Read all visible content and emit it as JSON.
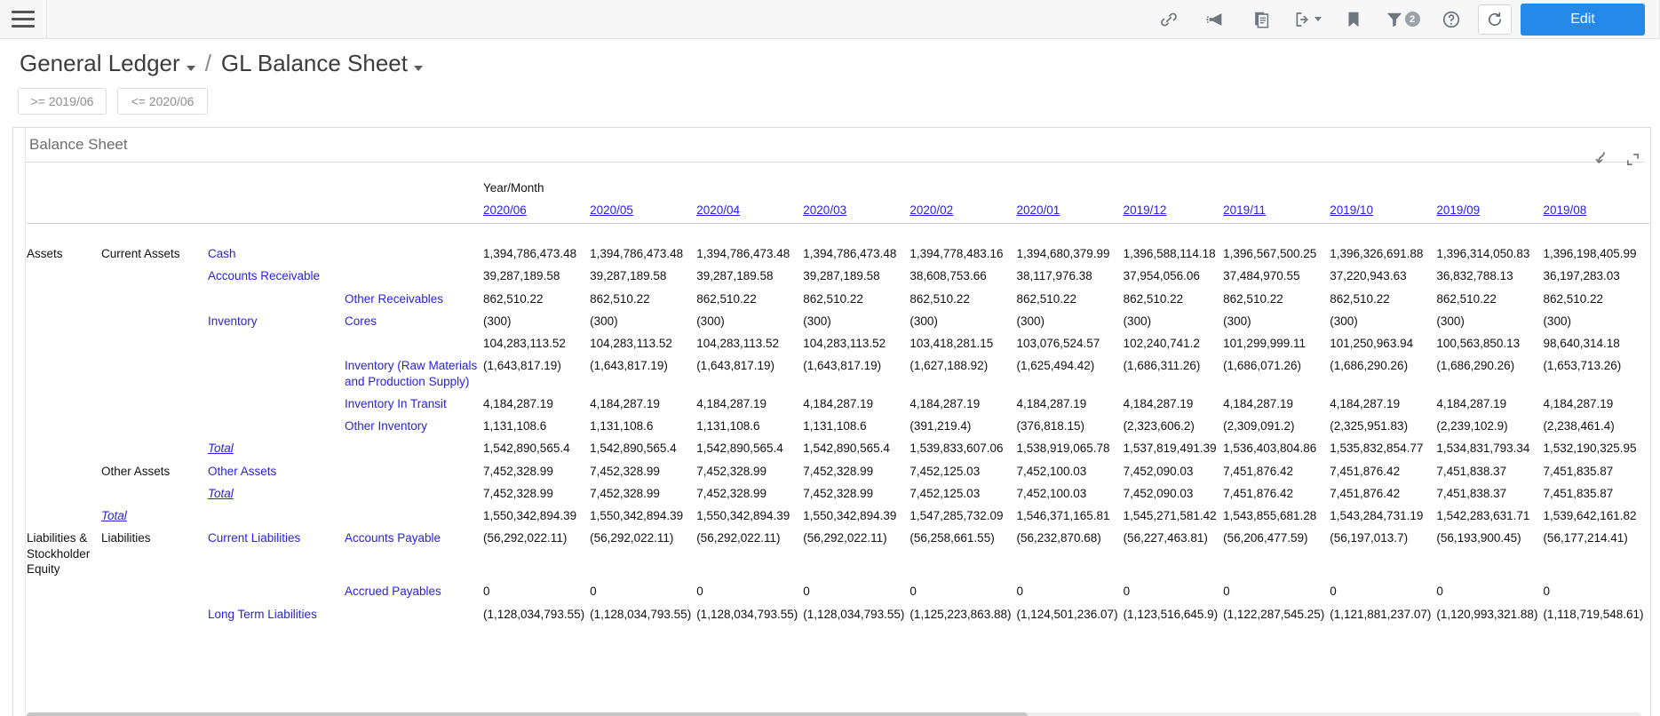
{
  "appbar": {
    "menu_icon": "hamburger-menu-icon",
    "icons": [
      {
        "name": "link-icon",
        "label": "Link"
      },
      {
        "name": "announce-icon",
        "label": "Announce"
      },
      {
        "name": "copy-icon",
        "label": "Copy"
      },
      {
        "name": "export-icon",
        "label": "Export"
      },
      {
        "name": "bookmark-icon",
        "label": "Bookmark"
      },
      {
        "name": "filter-icon",
        "label": "Filter"
      },
      {
        "name": "help-icon",
        "label": "Help"
      }
    ],
    "filter_badge": "2",
    "refresh_label": "Refresh",
    "edit_label": "Edit",
    "accent_color": "#2489e8"
  },
  "breadcrumb": {
    "root": "General Ledger",
    "separator": "/",
    "current": "GL Balance Sheet"
  },
  "filters": [
    {
      "name": "date-from-chip",
      "label": ">= 2019/06"
    },
    {
      "name": "date-to-chip",
      "label": "<= 2020/06"
    }
  ],
  "report": {
    "title": "Balance Sheet",
    "header_label": "Year/Month",
    "months": [
      "2020/06",
      "2020/05",
      "2020/04",
      "2020/03",
      "2020/02",
      "2020/01",
      "2019/12",
      "2019/11",
      "2019/10",
      "2019/09",
      "2019/08"
    ],
    "total_label": "Total"
  },
  "chart_data": {
    "type": "table",
    "title": "Balance Sheet",
    "xlabel": "Year/Month",
    "categories": [
      "2020/06",
      "2020/05",
      "2020/04",
      "2020/03",
      "2020/02",
      "2020/01",
      "2019/12",
      "2019/11",
      "2019/10",
      "2019/09",
      "2019/08"
    ],
    "rows": [
      {
        "dim1": "Assets",
        "dim2": "Current Assets",
        "dim3": "Cash",
        "dim4": "",
        "kind": "data",
        "values": [
          "1,394,786,473.48",
          "1,394,786,473.48",
          "1,394,786,473.48",
          "1,394,786,473.48",
          "1,394,778,483.16",
          "1,394,680,379.99",
          "1,396,588,114.18",
          "1,396,567,500.25",
          "1,396,326,691.88",
          "1,396,314,050.83",
          "1,396,198,405.99"
        ]
      },
      {
        "dim1": "",
        "dim2": "",
        "dim3": "Accounts Receivable",
        "dim4": "",
        "kind": "data",
        "values": [
          "39,287,189.58",
          "39,287,189.58",
          "39,287,189.58",
          "39,287,189.58",
          "38,608,753.66",
          "38,117,976.38",
          "37,954,056.06",
          "37,484,970.55",
          "37,220,943.63",
          "36,832,788.13",
          "36,197,283.03"
        ]
      },
      {
        "dim1": "",
        "dim2": "",
        "dim3": "",
        "dim4": "Other Receivables",
        "kind": "data",
        "values": [
          "862,510.22",
          "862,510.22",
          "862,510.22",
          "862,510.22",
          "862,510.22",
          "862,510.22",
          "862,510.22",
          "862,510.22",
          "862,510.22",
          "862,510.22",
          "862,510.22"
        ]
      },
      {
        "dim1": "",
        "dim2": "",
        "dim3": "Inventory",
        "dim4": "Cores",
        "kind": "data",
        "values": [
          "(300)",
          "(300)",
          "(300)",
          "(300)",
          "(300)",
          "(300)",
          "(300)",
          "(300)",
          "(300)",
          "(300)",
          "(300)"
        ]
      },
      {
        "dim1": "",
        "dim2": "",
        "dim3": "",
        "dim4": "",
        "kind": "data",
        "values": [
          "104,283,113.52",
          "104,283,113.52",
          "104,283,113.52",
          "104,283,113.52",
          "103,418,281.15",
          "103,076,524.57",
          "102,240,741.2",
          "101,299,999.11",
          "101,250,963.94",
          "100,563,850.13",
          "98,640,314.18"
        ]
      },
      {
        "dim1": "",
        "dim2": "",
        "dim3": "",
        "dim4": "Inventory (Raw Materials and Production Supply)",
        "kind": "data",
        "values": [
          "(1,643,817.19)",
          "(1,643,817.19)",
          "(1,643,817.19)",
          "(1,643,817.19)",
          "(1,627,188.92)",
          "(1,625,494.42)",
          "(1,686,311.26)",
          "(1,686,071.26)",
          "(1,686,290.26)",
          "(1,686,290.26)",
          "(1,653,713.26)"
        ]
      },
      {
        "dim1": "",
        "dim2": "",
        "dim3": "",
        "dim4": "Inventory In Transit",
        "kind": "data",
        "values": [
          "4,184,287.19",
          "4,184,287.19",
          "4,184,287.19",
          "4,184,287.19",
          "4,184,287.19",
          "4,184,287.19",
          "4,184,287.19",
          "4,184,287.19",
          "4,184,287.19",
          "4,184,287.19",
          "4,184,287.19"
        ]
      },
      {
        "dim1": "",
        "dim2": "",
        "dim3": "",
        "dim4": "Other Inventory",
        "kind": "data",
        "values": [
          "1,131,108.6",
          "1,131,108.6",
          "1,131,108.6",
          "1,131,108.6",
          "(391,219.4)",
          "(376,818.15)",
          "(2,323,606.2)",
          "(2,309,091.2)",
          "(2,325,951.83)",
          "(2,239,102.9)",
          "(2,238,461.4)"
        ]
      },
      {
        "dim1": "",
        "dim2": "",
        "dim3": "Total",
        "dim4": "",
        "kind": "total",
        "values": [
          "1,542,890,565.4",
          "1,542,890,565.4",
          "1,542,890,565.4",
          "1,542,890,565.4",
          "1,539,833,607.06",
          "1,538,919,065.78",
          "1,537,819,491.39",
          "1,536,403,804.86",
          "1,535,832,854.77",
          "1,534,831,793.34",
          "1,532,190,325.95"
        ]
      },
      {
        "dim1": "",
        "dim2": "Other Assets",
        "dim3": "Other Assets",
        "dim4": "",
        "kind": "data",
        "values": [
          "7,452,328.99",
          "7,452,328.99",
          "7,452,328.99",
          "7,452,328.99",
          "7,452,125.03",
          "7,452,100.03",
          "7,452,090.03",
          "7,451,876.42",
          "7,451,876.42",
          "7,451,838.37",
          "7,451,835.87"
        ]
      },
      {
        "dim1": "",
        "dim2": "",
        "dim3": "Total",
        "dim4": "",
        "kind": "total",
        "values": [
          "7,452,328.99",
          "7,452,328.99",
          "7,452,328.99",
          "7,452,328.99",
          "7,452,125.03",
          "7,452,100.03",
          "7,452,090.03",
          "7,451,876.42",
          "7,451,876.42",
          "7,451,838.37",
          "7,451,835.87"
        ]
      },
      {
        "dim1": "",
        "dim2": "Total",
        "dim3": "",
        "dim4": "",
        "kind": "grandtotal",
        "values": [
          "1,550,342,894.39",
          "1,550,342,894.39",
          "1,550,342,894.39",
          "1,550,342,894.39",
          "1,547,285,732.09",
          "1,546,371,165.81",
          "1,545,271,581.42",
          "1,543,855,681.28",
          "1,543,284,731.19",
          "1,542,283,631.71",
          "1,539,642,161.82"
        ]
      },
      {
        "dim1": "Liabilities & Stockholder Equity",
        "dim2": "Liabilities",
        "dim3": "Current Liabilities",
        "dim4": "Accounts Payable",
        "kind": "data",
        "values": [
          "(56,292,022.11)",
          "(56,292,022.11)",
          "(56,292,022.11)",
          "(56,292,022.11)",
          "(56,258,661.55)",
          "(56,232,870.68)",
          "(56,227,463.81)",
          "(56,206,477.59)",
          "(56,197,013.7)",
          "(56,193,900.45)",
          "(56,177,214.41)"
        ]
      },
      {
        "dim1": "",
        "dim2": "",
        "dim3": "",
        "dim4": "Accrued Payables",
        "kind": "data",
        "values": [
          "0",
          "0",
          "0",
          "0",
          "0",
          "0",
          "0",
          "0",
          "0",
          "0",
          "0"
        ]
      },
      {
        "dim1": "",
        "dim2": "",
        "dim3": "Long Term Liabilities",
        "dim4": "",
        "kind": "data",
        "values": [
          "(1,128,034,793.55)",
          "(1,128,034,793.55)",
          "(1,128,034,793.55)",
          "(1,128,034,793.55)",
          "(1,125,223,863.88)",
          "(1,124,501,236.07)",
          "(1,123,516,645.9)",
          "(1,122,287,545.25)",
          "(1,121,881,237.07)",
          "(1,120,993,321.88)",
          "(1,118,719,548.61)"
        ]
      }
    ]
  }
}
